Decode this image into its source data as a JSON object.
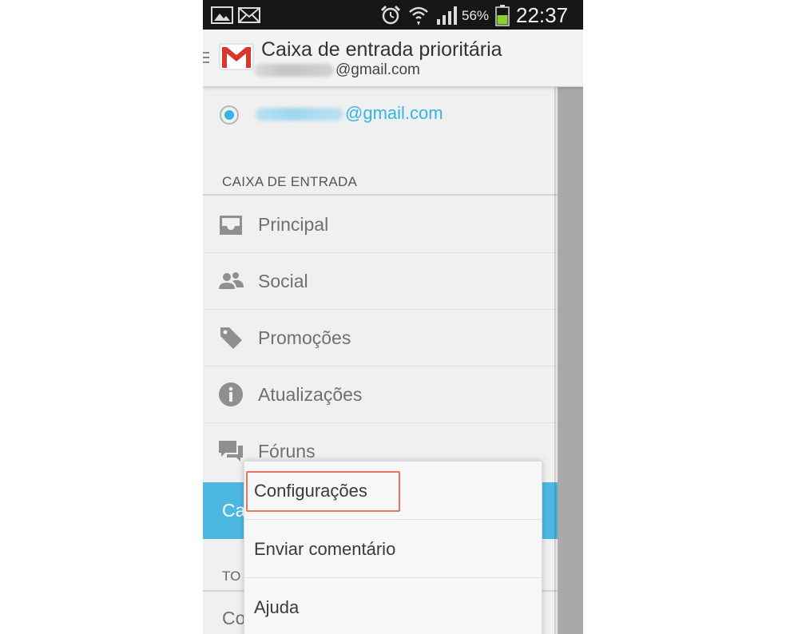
{
  "status_bar": {
    "battery_percent": "56%",
    "time": "22:37",
    "icons": [
      "image-notification-icon",
      "mail-notification-icon",
      "alarm-icon",
      "wifi-icon",
      "signal-icon",
      "battery-icon"
    ]
  },
  "action_bar": {
    "title": "Caixa de entrada prioritária",
    "account_email_suffix": "@gmail.com",
    "icons": [
      "menu-icon",
      "gmail-logo-icon"
    ]
  },
  "drawer": {
    "account": {
      "email_suffix": "@gmail.com",
      "selected": true
    },
    "section_inbox": "CAIXA DE ENTRADA",
    "items": [
      {
        "label": "Principal",
        "icon": "inbox-icon"
      },
      {
        "label": "Social",
        "icon": "people-icon"
      },
      {
        "label": "Promoções",
        "icon": "tag-icon"
      },
      {
        "label": "Atualizações",
        "icon": "info-icon"
      },
      {
        "label": "Fóruns",
        "icon": "forum-icon"
      }
    ],
    "selected_item_partial": "Ca",
    "section_all_partial": "TO",
    "next_item_partial": "Co"
  },
  "menu": {
    "items": [
      {
        "label": "Configurações",
        "highlighted": true
      },
      {
        "label": "Enviar comentário"
      },
      {
        "label": "Ajuda"
      }
    ]
  },
  "colors": {
    "accent": "#33b5e5",
    "selected_row": "#4cb8e2",
    "highlight_box": "#e8735e",
    "gmail_red": "#d9372b"
  }
}
